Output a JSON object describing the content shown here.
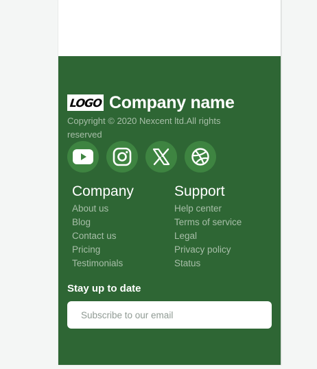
{
  "brand": {
    "logo_text": "LOGO",
    "company_name": "Company name",
    "copyright": "Copyright © 2020 Nexcent ltd.All rights reserved"
  },
  "socials": [
    {
      "icon": "youtube-icon"
    },
    {
      "icon": "instagram-icon"
    },
    {
      "icon": "x-icon"
    },
    {
      "icon": "dribbble-icon"
    }
  ],
  "company_column": {
    "title": "Company",
    "links": [
      "About us",
      "Blog",
      "Contact us",
      "Pricing",
      "Testimonials"
    ]
  },
  "support_column": {
    "title": "Support",
    "links": [
      "Help center",
      "Terms of service",
      "Legal",
      "Privacy policy",
      "Status"
    ]
  },
  "newsletter": {
    "heading": "Stay up to date",
    "placeholder": "Subscribe to our email",
    "value": ""
  },
  "colors": {
    "footer_bg": "#2e6634",
    "social_bg": "#3e8441",
    "link": "#a8bfa9",
    "white": "#ffffff"
  }
}
